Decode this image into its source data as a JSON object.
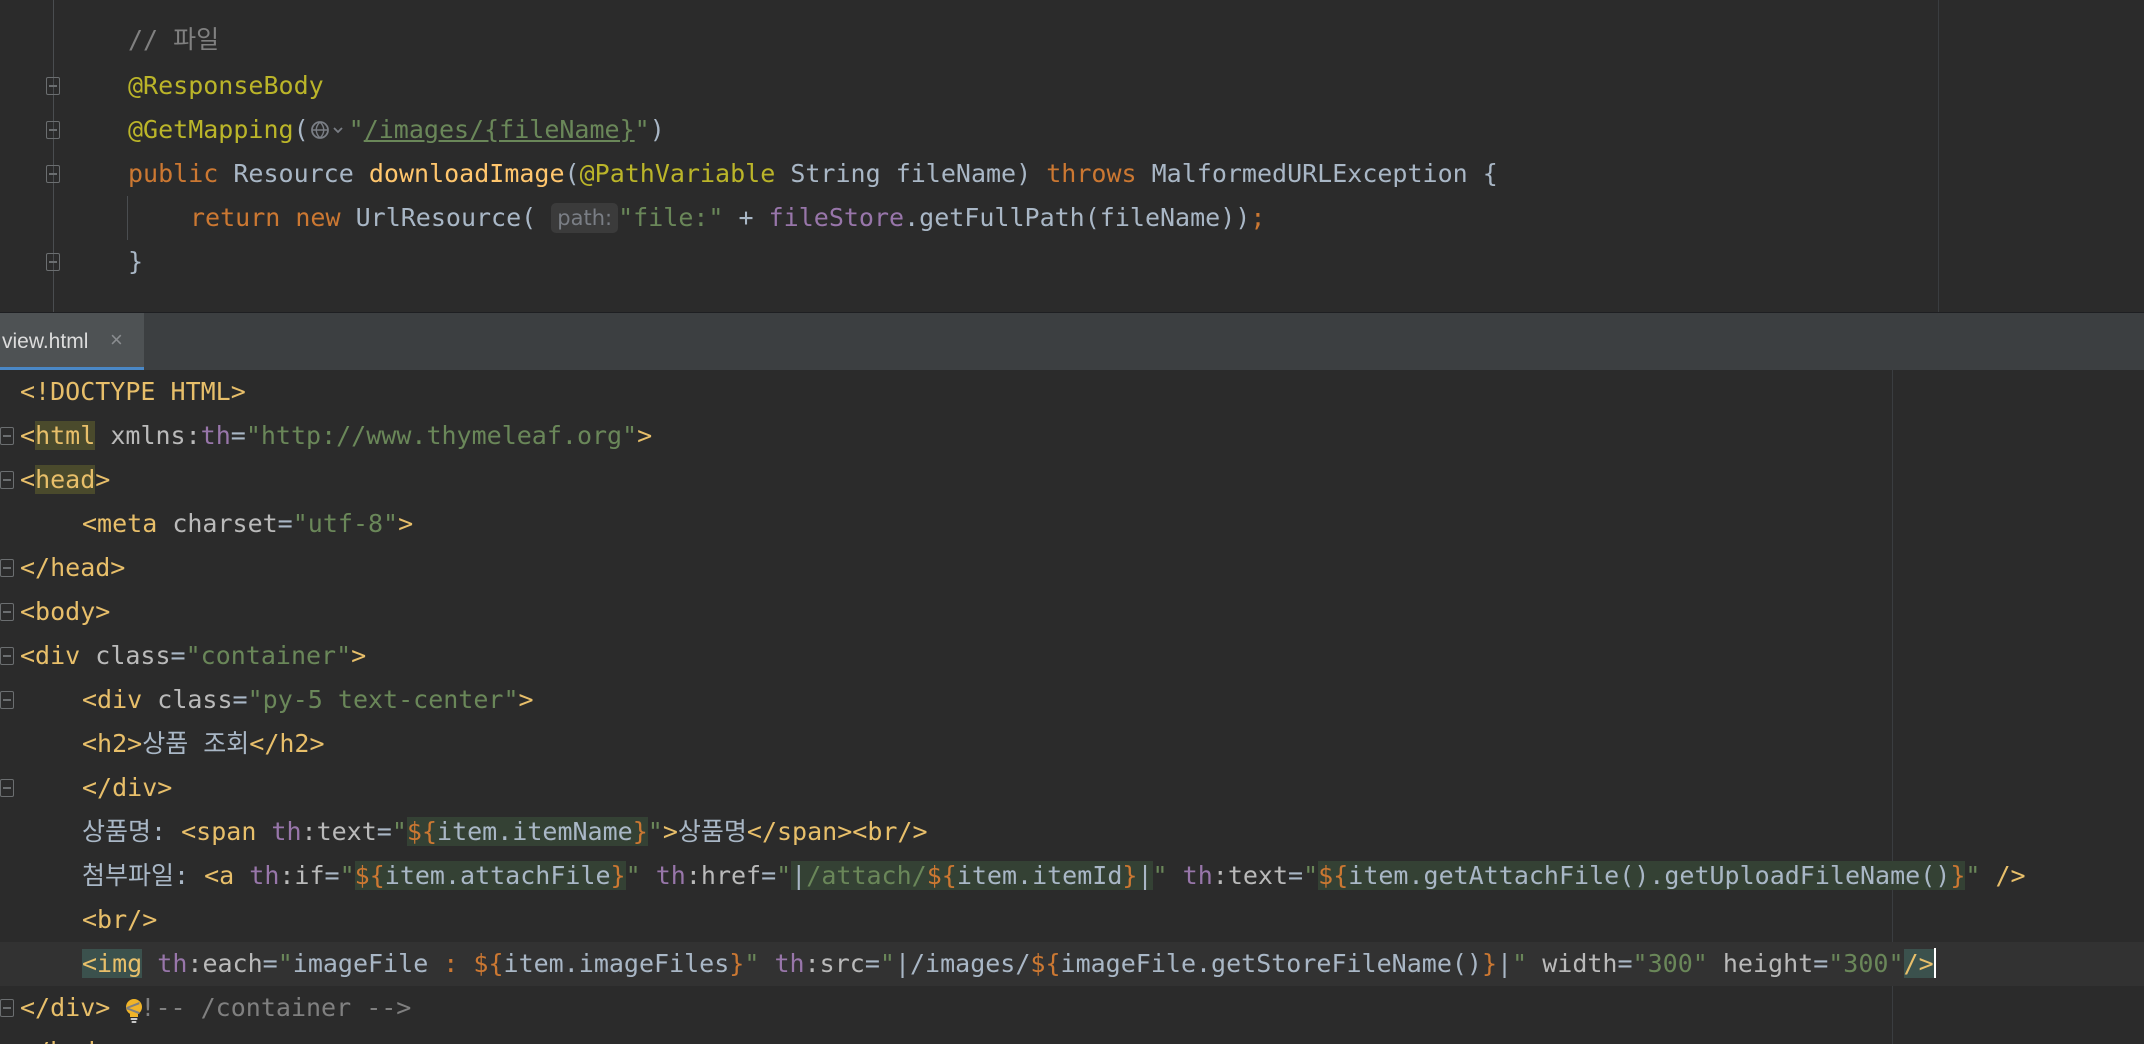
{
  "editor_top": {
    "lines": {
      "comment": "// 파일",
      "response_body": "@ResponseBody",
      "get_mapping_annotation": "@GetMapping",
      "get_mapping_url": "/images/{fileName}",
      "public_kw": "public",
      "resource_type": "Resource",
      "method_name": "downloadImage",
      "path_variable": "@PathVariable",
      "string_type": "String",
      "param_name": "fileName",
      "throws_kw": "throws",
      "exception": "MalformedURLException",
      "return_kw": "return",
      "new_kw": "new",
      "url_resource": "UrlResource",
      "path_hint": "path:",
      "file_prefix": "\"file:\"",
      "file_store": "fileStore",
      "get_full_path": "getFullPath",
      "closing_brace": "}"
    }
  },
  "tab": {
    "filename": "view.html",
    "close_icon": "×"
  },
  "editor_bottom": {
    "doctype": "<!DOCTYPE HTML>",
    "thymeleaf_ns": "\"http://www.thymeleaf.org\"",
    "charset": "\"utf-8\"",
    "container_class": "\"container\"",
    "py5_class": "\"py-5 text-center\"",
    "h2_text": "상품 조회",
    "item_name_label": "상품명: ",
    "item_name_expr": "${item.itemName}",
    "item_name_fallback": "상품명",
    "attach_label": "첨부파일: ",
    "attach_if_expr": "${item.attachFile}",
    "attach_href_prefix": "/attach/",
    "attach_href_expr": "${item.itemId}",
    "attach_text_expr": "${item.getAttachFile().getUploadFileName()}",
    "img_each_var": "imageFile",
    "img_each_expr": "${item.imageFiles}",
    "img_src_prefix": "/images/",
    "img_src_expr": "${imageFile.getStoreFileName()}",
    "img_width": "\"300\"",
    "img_height": "\"300\"",
    "container_end_comment": "<!-- /container -->"
  },
  "icons": {
    "bulb": "lightbulb-icon",
    "globe": "globe-icon"
  },
  "colors": {
    "background": "#2b2b2b",
    "keyword": "#cc7832",
    "string": "#6a8759",
    "annotation": "#bbb529",
    "tag": "#e8bf6a",
    "field": "#9876aa",
    "tab_accent": "#4a88c7"
  }
}
